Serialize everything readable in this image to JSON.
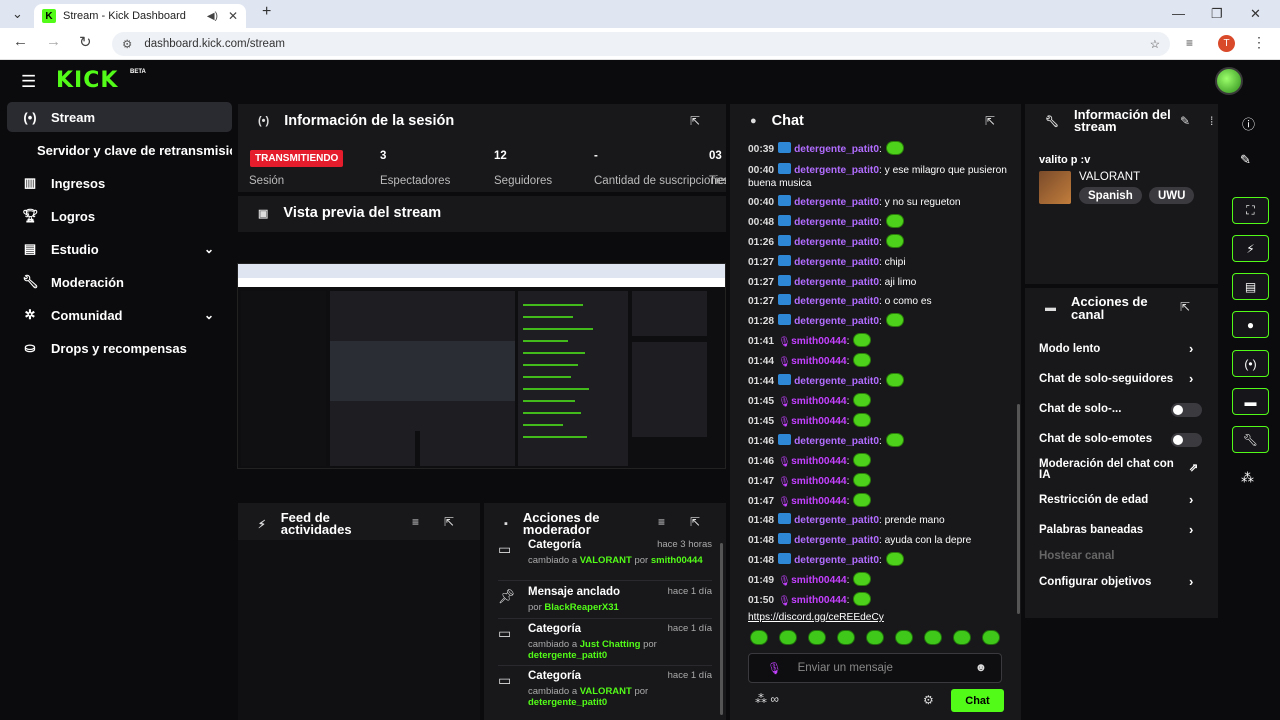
{
  "browser": {
    "tab_title": "Stream - Kick Dashboard",
    "url": "dashboard.kick.com/stream",
    "profile_initial": "T"
  },
  "app": {
    "logo": "KICK",
    "beta": "BETA"
  },
  "sidebar": {
    "items": [
      {
        "label": "Stream",
        "icon": "stream-icon"
      },
      {
        "label": "Ingresos",
        "icon": "chart-icon"
      },
      {
        "label": "Logros",
        "icon": "trophy-icon"
      },
      {
        "label": "Estudio",
        "icon": "studio-icon"
      },
      {
        "label": "Moderación",
        "icon": "wrench-icon"
      },
      {
        "label": "Comunidad",
        "icon": "community-icon"
      },
      {
        "label": "Drops y recompensas",
        "icon": "drops-icon"
      }
    ],
    "subitem": "Servidor y clave de retransmisión"
  },
  "session": {
    "title": "Información de la sesión",
    "status": "TRANSMITIENDO",
    "status_label": "Sesión",
    "stats": [
      {
        "value": "3",
        "label": "Espectadores"
      },
      {
        "value": "12",
        "label": "Seguidores"
      },
      {
        "value": "-",
        "label": "Cantidad de suscripciones"
      },
      {
        "value": "03",
        "label": "Tiempo"
      }
    ]
  },
  "preview": {
    "title": "Vista previa del stream"
  },
  "activity": {
    "title": "Feed de actividades"
  },
  "mod": {
    "title": "Acciones de moderador",
    "rows": [
      {
        "title": "Categoría",
        "time": "hace 3 horas",
        "pre": "cambiado a ",
        "hl": "VALORANT",
        "mid": " por ",
        "user": "smith00444"
      },
      {
        "title": "Mensaje anclado",
        "time": "hace 1 día",
        "pre": "por ",
        "hl": "BlackReaperX31",
        "mid": "",
        "user": ""
      },
      {
        "title": "Categoría",
        "time": "hace 1 día",
        "pre": "cambiado a ",
        "hl": "Just Chatting",
        "mid": " por ",
        "user": "detergente_patit0"
      },
      {
        "title": "Categoría",
        "time": "hace 1 día",
        "pre": "cambiado a ",
        "hl": "VALORANT",
        "mid": " por ",
        "user": "detergente_patit0"
      }
    ]
  },
  "chat": {
    "title": "Chat",
    "messages": [
      {
        "t": "00:39",
        "u": "detergente_patit0",
        "m": ":",
        "b": "pr"
      },
      {
        "t": "00:40",
        "u": "detergente_patit0",
        "m": ": y ese milagro que pusieron buena musica",
        "b": "pr"
      },
      {
        "t": "00:40",
        "u": "detergente_patit0",
        "m": ": y no su regueton",
        "b": "pr"
      },
      {
        "t": "00:48",
        "u": "detergente_patit0",
        "m": ":",
        "b": "pr"
      },
      {
        "t": "01:26",
        "u": "detergente_patit0",
        "m": ":",
        "b": "pr"
      },
      {
        "t": "01:27",
        "u": "detergente_patit0",
        "m": ": chipi",
        "b": "pr"
      },
      {
        "t": "01:27",
        "u": "detergente_patit0",
        "m": ": aji limo",
        "b": "pr"
      },
      {
        "t": "01:27",
        "u": "detergente_patit0",
        "m": ": o como es",
        "b": "pr"
      },
      {
        "t": "01:28",
        "u": "detergente_patit0",
        "m": ":",
        "b": "pr"
      },
      {
        "t": "01:41",
        "u": "smith00444",
        "m": ":",
        "b": "mic"
      },
      {
        "t": "01:44",
        "u": "smith00444",
        "m": ":",
        "b": "mic"
      },
      {
        "t": "01:44",
        "u": "detergente_patit0",
        "m": ":",
        "b": "pr"
      },
      {
        "t": "01:45",
        "u": "smith00444",
        "m": ":",
        "b": "mic"
      },
      {
        "t": "01:45",
        "u": "smith00444",
        "m": ":",
        "b": "mic"
      },
      {
        "t": "01:46",
        "u": "detergente_patit0",
        "m": ":",
        "b": "pr"
      },
      {
        "t": "01:46",
        "u": "smith00444",
        "m": ":",
        "b": "mic"
      },
      {
        "t": "01:47",
        "u": "smith00444",
        "m": ":",
        "b": "mic"
      },
      {
        "t": "01:47",
        "u": "smith00444",
        "m": ":",
        "b": "mic"
      },
      {
        "t": "01:48",
        "u": "detergente_patit0",
        "m": ": prende mano",
        "b": "pr"
      },
      {
        "t": "01:48",
        "u": "detergente_patit0",
        "m": ": ayuda con la depre",
        "b": "pr"
      },
      {
        "t": "01:48",
        "u": "detergente_patit0",
        "m": ":",
        "b": "pr"
      },
      {
        "t": "01:49",
        "u": "smith00444",
        "m": ":",
        "b": "mic"
      },
      {
        "t": "01:50",
        "u": "smith00444",
        "m": ":",
        "b": "mic"
      }
    ],
    "link": "https://discord.gg/ceREEdeCy",
    "placeholder": "Enviar un mensaje",
    "send_label": "Chat"
  },
  "stream_info": {
    "title": "Información del stream",
    "stream_title": "valito p :v",
    "category": "VALORANT",
    "tags": [
      "Spanish",
      "UWU"
    ]
  },
  "channel_actions": {
    "title": "Acciones de canal",
    "items": [
      {
        "label": "Modo lento",
        "kind": "arrow"
      },
      {
        "label": "Chat de solo-seguidores",
        "kind": "arrow"
      },
      {
        "label": "Chat de solo-...",
        "kind": "toggle"
      },
      {
        "label": "Chat de solo-emotes",
        "kind": "toggle"
      },
      {
        "label": "Moderación del chat con IA",
        "kind": "chart"
      },
      {
        "label": "Restricción de edad",
        "kind": "arrow"
      },
      {
        "label": "Palabras baneadas",
        "kind": "arrow"
      },
      {
        "label": "Hostear canal",
        "kind": "disabled"
      },
      {
        "label": "Configurar objetivos",
        "kind": "arrow"
      }
    ]
  }
}
